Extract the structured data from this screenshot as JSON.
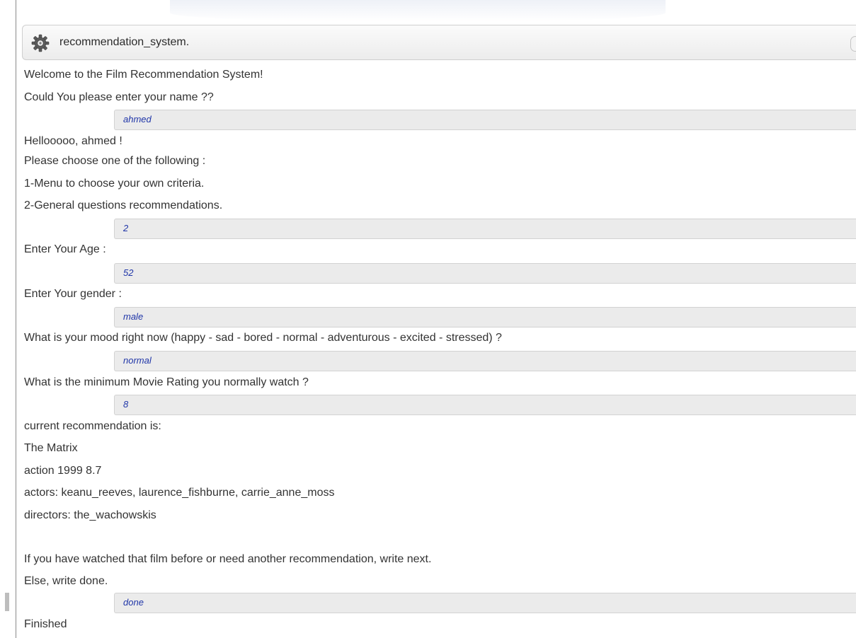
{
  "window": {
    "title": "recommendation_system.",
    "icon": "gear-icon"
  },
  "transcript": [
    {
      "kind": "output",
      "text": "Welcome to the Film Recommendation System!"
    },
    {
      "kind": "output",
      "text": "Could You please enter your name ??"
    },
    {
      "kind": "input",
      "text": "ahmed"
    },
    {
      "kind": "output",
      "text": "Hellooooo, ahmed !"
    },
    {
      "kind": "output",
      "text": "Please choose one of the following :"
    },
    {
      "kind": "output",
      "text": "1-Menu to choose your own criteria."
    },
    {
      "kind": "output",
      "text": "2-General questions recommendations."
    },
    {
      "kind": "input",
      "text": "2"
    },
    {
      "kind": "output",
      "text": "Enter Your Age :"
    },
    {
      "kind": "input",
      "text": "52"
    },
    {
      "kind": "output",
      "text": "Enter Your gender :"
    },
    {
      "kind": "input",
      "text": "male"
    },
    {
      "kind": "output",
      "text": "What is your mood right now (happy - sad - bored - normal - adventurous - excited - stressed) ?"
    },
    {
      "kind": "input",
      "text": "normal"
    },
    {
      "kind": "output",
      "text": "What is the minimum Movie Rating you normally watch ?"
    },
    {
      "kind": "input",
      "text": "8"
    },
    {
      "kind": "output",
      "text": "current recommendation is:"
    },
    {
      "kind": "output",
      "text": "The Matrix"
    },
    {
      "kind": "output",
      "text": "action 1999 8.7"
    },
    {
      "kind": "output",
      "text": "actors: keanu_reeves, laurence_fishburne, carrie_anne_moss"
    },
    {
      "kind": "output",
      "text": "directors: the_wachowskis"
    },
    {
      "kind": "output",
      "text": "If you have watched that film before or need another recommendation, write next."
    },
    {
      "kind": "output",
      "text": "Else, write done."
    },
    {
      "kind": "input",
      "text": "done"
    },
    {
      "kind": "output",
      "text": "Finished"
    }
  ],
  "colors": {
    "text": "#333333",
    "input_text": "#1f35a8",
    "input_background": "#ebebeb"
  }
}
